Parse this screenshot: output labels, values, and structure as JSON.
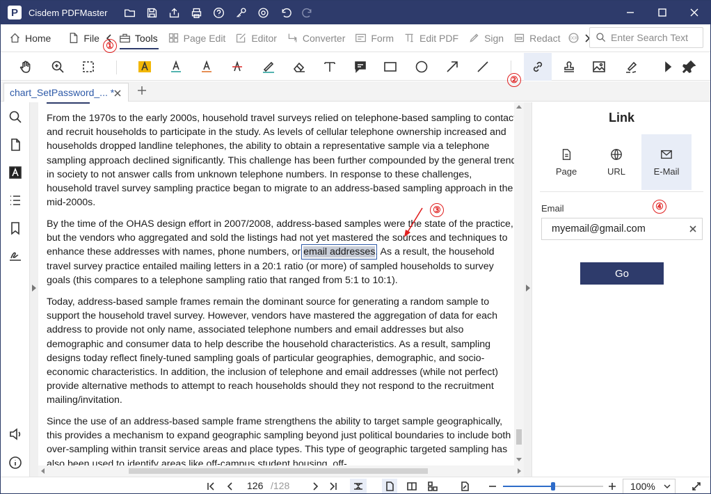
{
  "app": {
    "title": "Cisdem PDFMaster",
    "logo_letter": "P",
    "accent": "#2e3b6b"
  },
  "menu": {
    "tabs": [
      {
        "label": "Home",
        "icon": "home-icon"
      },
      {
        "label": "File",
        "icon": "file-icon"
      },
      {
        "label": "Tools",
        "icon": "toolbox-icon",
        "active": true
      },
      {
        "label": "Page Edit",
        "icon": "grid-icon"
      },
      {
        "label": "Editor",
        "icon": "edit-icon"
      },
      {
        "label": "Converter",
        "icon": "convert-icon"
      },
      {
        "label": "Form",
        "icon": "form-icon"
      },
      {
        "label": "Edit PDF",
        "icon": "text-cursor-icon"
      },
      {
        "label": "Sign",
        "icon": "sign-icon"
      },
      {
        "label": "Redact",
        "icon": "redact-icon"
      }
    ],
    "ocr_label": "OCR",
    "search_placeholder": "Enter Search Text"
  },
  "markers": {
    "m1": "①",
    "m2": "②",
    "m3": "③",
    "m4": "④"
  },
  "doc_tab": {
    "title": "chart_SetPassword_... *"
  },
  "document": {
    "p1": "From the 1970s to the early 2000s, household travel surveys relied on telephone-based sampling to contact and recruit households to participate in the study. As levels of cellular telephone ownership increased and households dropped landline telephones, the ability to obtain a representative sample via a telephone sampling approach declined significantly. This challenge has been further compounded by the general trend in society to not answer calls from unknown telephone numbers. In response to these challenges, household travel survey sampling practice began to migrate to an address-based sampling approach in the mid-2000s.",
    "p2_before": "By the time of the OHAS design effort in 2007/2008, address-based samples were the state of the practice, but the vendors who aggregated and sold the listings had not yet mastered the sources and techniques to enhance these addresses with names, phone numbers, or ",
    "p2_highlight": "email addresses",
    "p2_after": ". As a result, the household travel survey practice entailed mailing letters in a 20:1 ratio (or more) of sampled households to survey goals (this compares to a telephone sampling ratio that ranged from 5:1 to 10:1).",
    "p3": "Today, address-based sample frames remain the dominant source for generating a random sample to support the household travel survey. However, vendors have mastered the aggregation of data for each address to provide not only name, associated telephone numbers and email addresses but also demographic and consumer data to help describe the household characteristics. As a result, sampling designs today reflect finely-tuned sampling goals of particular geographies, demographic, and socio-economic characteristics. In addition, the inclusion of telephone and email addresses (while not perfect) provide alternative methods to attempt to reach households should they not respond to the recruitment mailing/invitation.",
    "p4": "Since the use of an address-based sample frame strengthens the ability to target sample geographically, this provides a mechanism to expand geographic sampling beyond just political boundaries to include both over-sampling within transit service areas and place types. This type of geographic targeted sampling has also been used to identify areas like off-campus student housing, off-"
  },
  "panel": {
    "title": "Link",
    "types": [
      {
        "label": "Page",
        "icon": "page-icon"
      },
      {
        "label": "URL",
        "icon": "globe-icon"
      },
      {
        "label": "E-Mail",
        "icon": "mail-icon",
        "active": true
      }
    ],
    "email_label": "Email",
    "email_value": "myemail@gmail.com",
    "go_label": "Go"
  },
  "status": {
    "page_current": "126",
    "page_total": "/128",
    "zoom": "100%",
    "zoom_level_fraction": 0.5
  }
}
